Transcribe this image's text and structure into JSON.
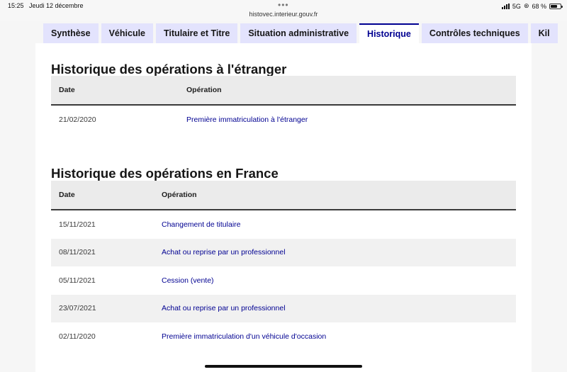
{
  "status_bar": {
    "time": "15:25",
    "date": "Jeudi 12 décembre",
    "url": "histovec.interieur.gouv.fr",
    "network": "5G",
    "battery": "68 %",
    "battery_level": 0.68
  },
  "tabs": [
    {
      "label": "Synthèse"
    },
    {
      "label": "Véhicule"
    },
    {
      "label": "Titulaire et Titre"
    },
    {
      "label": "Situation administrative"
    },
    {
      "label": "Historique",
      "active": true
    },
    {
      "label": "Contrôles techniques"
    },
    {
      "label": "Kil"
    }
  ],
  "foreign": {
    "title": "Historique des opérations à l'étranger",
    "col_date": "Date",
    "col_operation": "Opération",
    "rows": [
      {
        "date": "21/02/2020",
        "operation": "Première immatriculation à l'étranger"
      }
    ]
  },
  "france": {
    "title": "Historique des opérations en France",
    "col_date": "Date",
    "col_operation": "Opération",
    "rows": [
      {
        "date": "15/11/2021",
        "operation": "Changement de titulaire"
      },
      {
        "date": "08/11/2021",
        "operation": "Achat ou reprise par un professionnel"
      },
      {
        "date": "05/11/2021",
        "operation": "Cession (vente)"
      },
      {
        "date": "23/07/2021",
        "operation": "Achat ou reprise par un professionnel"
      },
      {
        "date": "02/11/2020",
        "operation": "Première immatriculation d'un véhicule d'occasion"
      }
    ]
  },
  "colors": {
    "accent": "#000091",
    "tab_bg": "#e3e3fd",
    "header_bg": "#ebebeb",
    "stripe_bg": "#f1f1f1"
  }
}
